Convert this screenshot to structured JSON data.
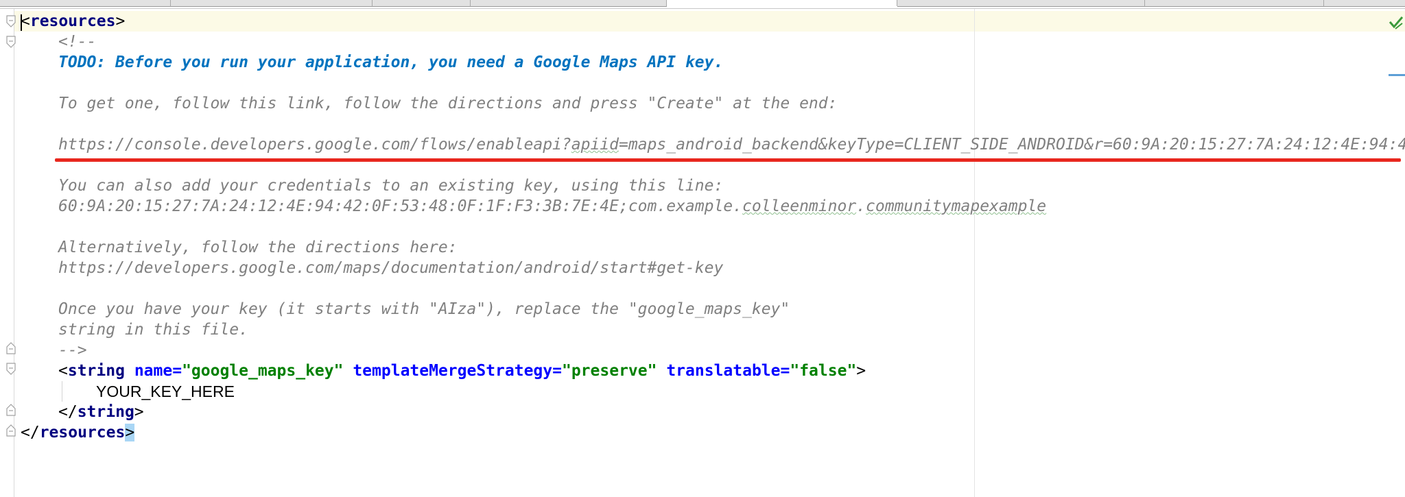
{
  "editor": {
    "lines": [
      {
        "open": "<",
        "tag": "resources",
        "close": ">"
      },
      {
        "text": "<!--"
      },
      {
        "text": "TODO: Before you run your application, you need a Google Maps API key."
      },
      {
        "text": ""
      },
      {
        "text": "To get one, follow this link, follow the directions and press \"Create\" at the end:"
      },
      {
        "text": ""
      },
      {
        "pre": "https://console.developers.google.com/flows/enableapi?",
        "sq": "apiid",
        "post": "=maps_android_backend&keyType=CLIENT_SIDE_ANDROID&r=60:9A:20:15:27:7A:24:12:4E:94:4"
      },
      {
        "text": ""
      },
      {
        "text": "You can also add your credentials to an existing key, using this line:"
      },
      {
        "pre": "60:9A:20:15:27:7A:24:12:4E:94:42:0F:53:48:0F:1F:F3:3B:7E:4E;com.example.",
        "sq1": "colleenminor",
        "dot": ".",
        "sq2": "communitymapexample"
      },
      {
        "text": ""
      },
      {
        "text": "Alternatively, follow the directions here:"
      },
      {
        "text": "https://developers.google.com/maps/documentation/android/start#get-key"
      },
      {
        "text": ""
      },
      {
        "text": "Once you have your key (it starts with \"AIza\"), replace the \"google_maps_key\""
      },
      {
        "text": "string in this file."
      },
      {
        "text": "-->"
      },
      {
        "lt": "<",
        "tag": "string",
        "a1": "name",
        "eq1": "=",
        "v1": "\"google_maps_key\"",
        "a2": "templateMergeStrategy",
        "eq2": "=",
        "v2": "\"preserve\"",
        "a3": "translatable",
        "eq3": "=",
        "v3": "\"false\"",
        "gt": ">"
      },
      {
        "text": "YOUR_KEY_HERE"
      },
      {
        "open": "</",
        "tag": "string",
        "close": ">"
      },
      {
        "open": "</",
        "tag": "resources",
        "close": ">"
      }
    ]
  },
  "icons": {
    "fold": "fold-marker-icon",
    "status": "check-icon"
  },
  "colors": {
    "tag": "#000080",
    "attribute": "#0000ff",
    "value": "#008000",
    "comment": "#808080",
    "todo": "#0073bf",
    "annotation": "#e8271e"
  }
}
